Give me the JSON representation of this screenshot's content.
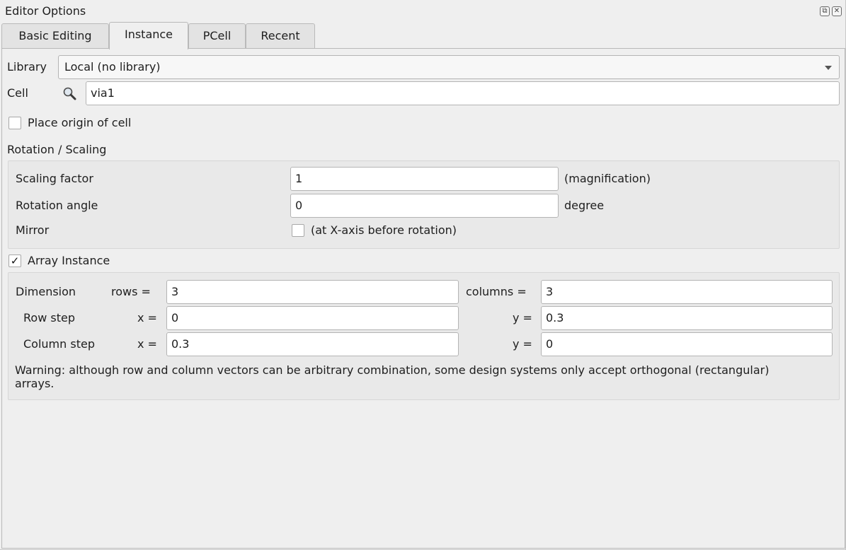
{
  "window": {
    "title": "Editor Options"
  },
  "tabs": [
    {
      "label": "Basic Editing",
      "active": false
    },
    {
      "label": "Instance",
      "active": true
    },
    {
      "label": "PCell",
      "active": false
    },
    {
      "label": "Recent",
      "active": false
    }
  ],
  "library": {
    "label": "Library",
    "value": "Local (no library)"
  },
  "cell": {
    "label": "Cell",
    "value": "via1"
  },
  "place_origin": {
    "label": "Place origin of cell",
    "checked": false
  },
  "rotation_scaling": {
    "title": "Rotation / Scaling",
    "scaling_label": "Scaling factor",
    "scaling_value": "1",
    "scaling_unit": "(magnification)",
    "rotation_label": "Rotation angle",
    "rotation_value": "0",
    "rotation_unit": "degree",
    "mirror_label": "Mirror",
    "mirror_text": "(at X-axis before rotation)",
    "mirror_checked": false
  },
  "array": {
    "label": "Array Instance",
    "checked": true,
    "check_glyph": "✓",
    "dimension_label": "Dimension",
    "rows_label": "rows =",
    "rows_value": "3",
    "columns_label": "columns =",
    "columns_value": "3",
    "row_step_label": "Row step",
    "row_x_label": "x =",
    "row_x_value": "0",
    "row_y_label": "y =",
    "row_y_value": "0.3",
    "column_step_label": "Column step",
    "col_x_label": "x =",
    "col_x_value": "0.3",
    "col_y_label": "y =",
    "col_y_value": "0",
    "warning": "Warning: although row and column vectors can be arbitrary combination, some design systems only accept orthogonal (rectangular) arrays."
  },
  "icons": {
    "float": "⧉",
    "close": "✕",
    "search": "magnifier-icon"
  }
}
